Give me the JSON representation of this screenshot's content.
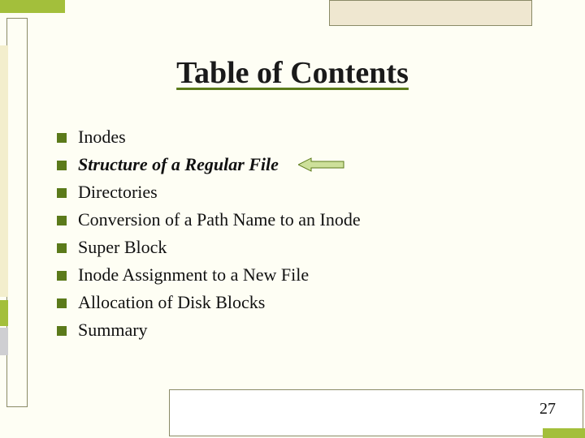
{
  "title": "Table of Contents",
  "items": [
    {
      "label": "Inodes",
      "emphasis": false,
      "pointer": false
    },
    {
      "label": "Structure of a Regular File",
      "emphasis": true,
      "pointer": true
    },
    {
      "label": "Directories",
      "emphasis": false,
      "pointer": false
    },
    {
      "label": "Conversion of a Path Name to an Inode",
      "emphasis": false,
      "pointer": false
    },
    {
      "label": "Super Block",
      "emphasis": false,
      "pointer": false
    },
    {
      "label": "Inode Assignment to a New File",
      "emphasis": false,
      "pointer": false
    },
    {
      "label": "Allocation of Disk Blocks",
      "emphasis": false,
      "pointer": false
    },
    {
      "label": "Summary",
      "emphasis": false,
      "pointer": false
    }
  ],
  "page_number": "27",
  "colors": {
    "accent_green": "#5b7a1a",
    "olive": "#a3bf3b",
    "pale_yellow": "#fefef4"
  },
  "icons": {
    "bullet": "square-bullet-icon",
    "pointer": "left-arrow-icon"
  }
}
